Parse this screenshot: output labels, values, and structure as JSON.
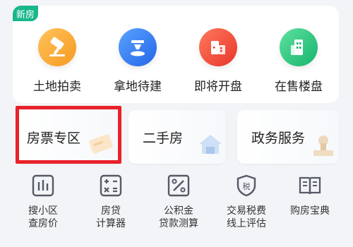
{
  "section_badge": "新房",
  "categories": [
    {
      "label": "土地拍卖",
      "icon": "auction-hammer-icon",
      "color": "#f6a22f"
    },
    {
      "label": "拿地待建",
      "icon": "construction-plot-icon",
      "color": "#2f7bf6"
    },
    {
      "label": "即将开盘",
      "icon": "house-opening-icon",
      "color": "#f0473a"
    },
    {
      "label": "在售楼盘",
      "icon": "building-icon",
      "color": "#1fc47c"
    }
  ],
  "tiles": [
    {
      "label": "房票专区",
      "icon": "ticket-icon",
      "highlighted": true
    },
    {
      "label": "二手房",
      "icon": "house-icon"
    },
    {
      "label": "政务服务",
      "icon": "stamp-icon"
    }
  ],
  "tools": [
    {
      "line1": "搜小区",
      "line2": "查房价",
      "icon": "bar-chart-icon"
    },
    {
      "line1": "房贷",
      "line2": "计算器",
      "icon": "calculator-icon"
    },
    {
      "line1": "公积金",
      "line2": "贷款测算",
      "icon": "percent-icon"
    },
    {
      "line1": "交易税费",
      "line2": "线上评估",
      "icon": "tax-shield-icon",
      "glyph": "税"
    },
    {
      "line1": "购房宝典",
      "line2": "",
      "icon": "book-icon"
    }
  ],
  "colors": {
    "highlight": "#e8212a",
    "badge": "#19b78b",
    "icon_stroke": "#555a66"
  }
}
